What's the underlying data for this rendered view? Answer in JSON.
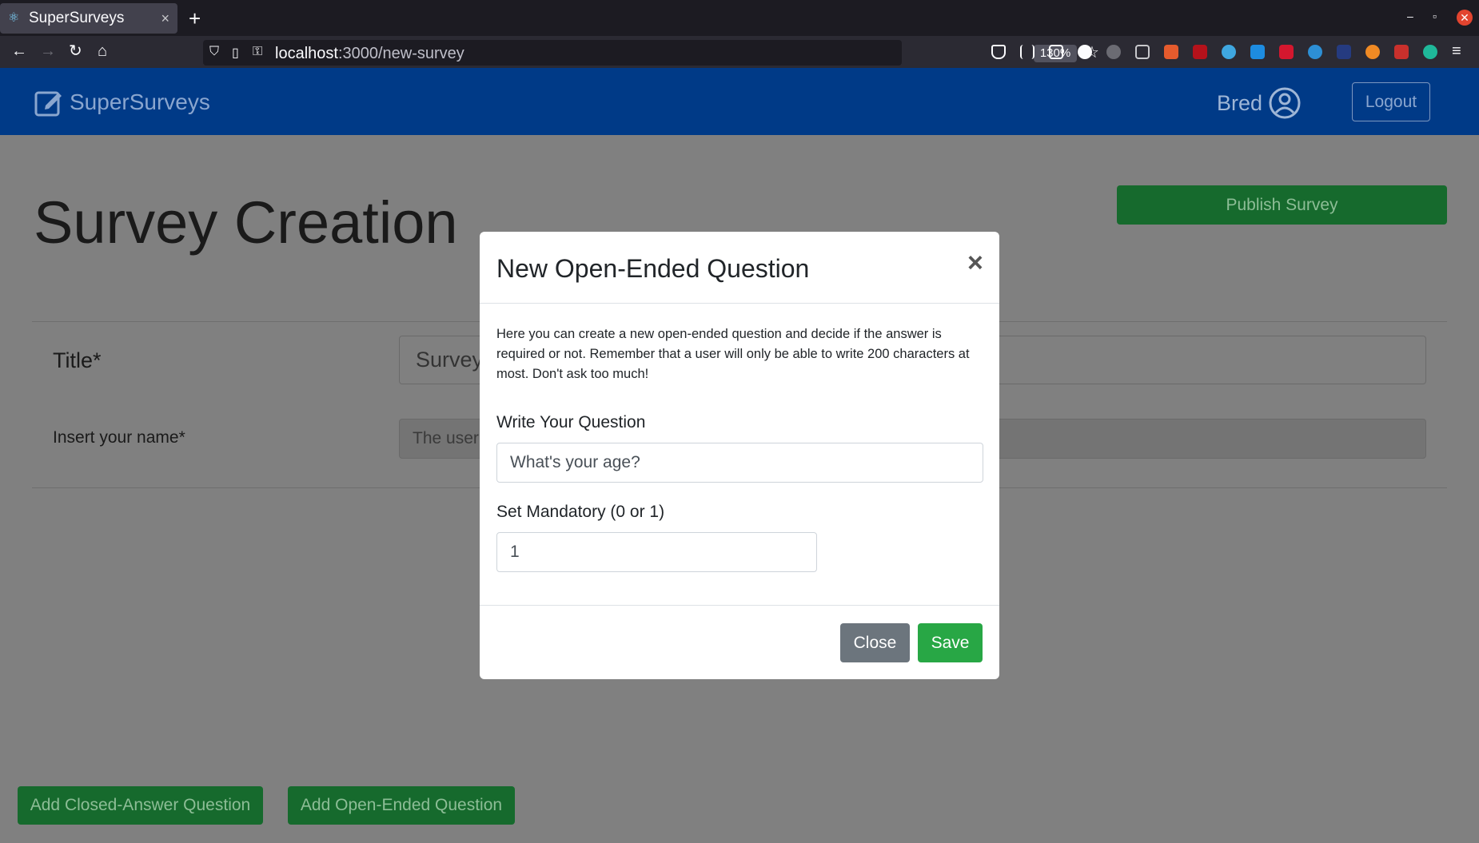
{
  "browser": {
    "tab_title": "SuperSurveys",
    "tab_close": "×",
    "new_tab": "+",
    "url_host": "localhost",
    "url_path": ":3000/new-survey",
    "zoom": "130%",
    "window_controls": {
      "minimize": "–",
      "restore": "▫",
      "close": "✕"
    }
  },
  "header": {
    "brand": "SuperSurveys",
    "username": "Bred",
    "logout_label": "Logout"
  },
  "page": {
    "title": "Survey Creation",
    "publish_label": "Publish Survey",
    "title_label": "Title*",
    "title_placeholder": "Survey",
    "name_label": "Insert your name*",
    "name_placeholder": "The user",
    "add_closed_label": "Add Closed-Answer Question",
    "add_open_label": "Add Open-Ended Question"
  },
  "modal": {
    "title": "New Open-Ended Question",
    "close_glyph": "×",
    "description": "Here you can create a new open-ended question and decide if the answer is required or not. Remember that a user will only be able to write 200 characters at most. Don't ask too much!",
    "question_label": "Write Your Question",
    "question_value": "What's your age?",
    "mandatory_label": "Set Mandatory (0 or 1)",
    "mandatory_value": "1",
    "close_label": "Close",
    "save_label": "Save"
  },
  "colors": {
    "header_bg": "#003a87",
    "overlay": "#808080",
    "publish_green": "#166a2d",
    "save_green": "#28a745",
    "close_gray": "#6c757d"
  }
}
